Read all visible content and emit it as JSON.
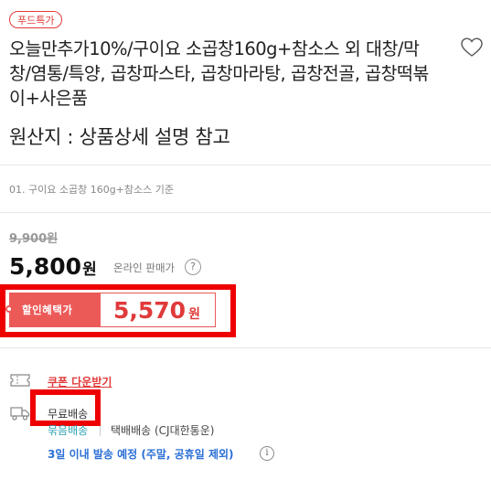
{
  "badge": "푸드특가",
  "product": {
    "title": "오늘만추가10%/구이요 소곱창160g+참소스 외 대창/막창/염통/특양, 곱창파스타, 곱창마라탕, 곱창전골, 곱창떡볶이+사은품",
    "origin": "원산지 : 상품상세 설명 참고",
    "option": "01. 구이요 소곱창 160g+참소스 기준"
  },
  "pricing": {
    "original": "9,900원",
    "price": "5,800",
    "currency": "원",
    "online_label": "온라인 판매가",
    "help_glyph": "?",
    "discount_label": "할인혜택가",
    "discount_price": "5,570",
    "discount_currency": "원"
  },
  "benefits": {
    "coupon": "쿠폰 다운받기",
    "free_shipping": "무료배송",
    "bundle": "묶음배송",
    "carrier": "택배배송 (CJ대한통운)",
    "dispatch": "3일 이내 발송 예정 (주말, 공휴일 제외)",
    "info_glyph": "i"
  },
  "colors": {
    "accent_red": "#e03a3a",
    "highlight_red": "#ee0000",
    "teal": "#2ea3b3",
    "blue": "#2b6fd6"
  },
  "icons": [
    "heart-icon",
    "coupon-icon",
    "truck-icon",
    "question-icon",
    "info-icon"
  ]
}
